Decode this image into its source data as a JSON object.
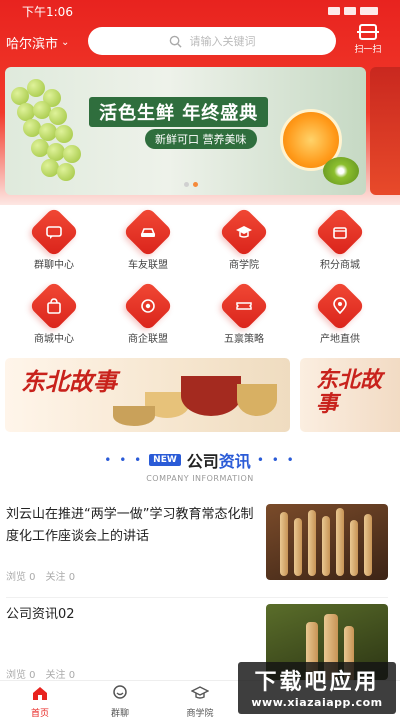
{
  "status_bar": {
    "time": "下午1:06"
  },
  "header": {
    "city": "哈尔滨市",
    "search_placeholder": "请输入关键词",
    "scan_label": "扫一扫"
  },
  "banner": {
    "top_text": "",
    "title": "活色生鲜 年终盛典",
    "subtitle": "新鲜可口 营养美味",
    "active_dot": 1,
    "dot_count": 2
  },
  "menu": [
    {
      "label": "群聊中心",
      "icon": "chat-icon"
    },
    {
      "label": "车友联盟",
      "icon": "car-icon"
    },
    {
      "label": "商学院",
      "icon": "graduation-cap-icon"
    },
    {
      "label": "积分商城",
      "icon": "points-store-icon"
    },
    {
      "label": "商城中心",
      "icon": "shopping-bag-icon"
    },
    {
      "label": "商企联盟",
      "icon": "coin-icon"
    },
    {
      "label": "五禀策略",
      "icon": "ticket-icon"
    },
    {
      "label": "产地直供",
      "icon": "location-icon"
    }
  ],
  "promo": {
    "calligraphy": "东北故事"
  },
  "news_section": {
    "badge": "NEW",
    "title_a": "公司",
    "title_b": "资讯",
    "subtitle": "COMPANY INFORMATION"
  },
  "news": [
    {
      "title": "刘云山在推进“两学一做”学习教育常态化制度化工作座谈会上的讲话",
      "views_label": "浏览 0",
      "follows_label": "关注 0"
    },
    {
      "title": "公司资讯02",
      "views_label": "浏览 0",
      "follows_label": "关注 0"
    }
  ],
  "tabbar": [
    {
      "label": "首页",
      "active": true
    },
    {
      "label": "群聊",
      "active": false
    },
    {
      "label": "商学院",
      "active": false
    },
    {
      "label": "",
      "active": false
    },
    {
      "label": "",
      "active": false
    }
  ],
  "watermark": {
    "main": "下载吧应用",
    "url": "www.xiazaiapp.com"
  },
  "colors": {
    "primary": "#e8231f",
    "accent_blue": "#2a5bd7"
  }
}
